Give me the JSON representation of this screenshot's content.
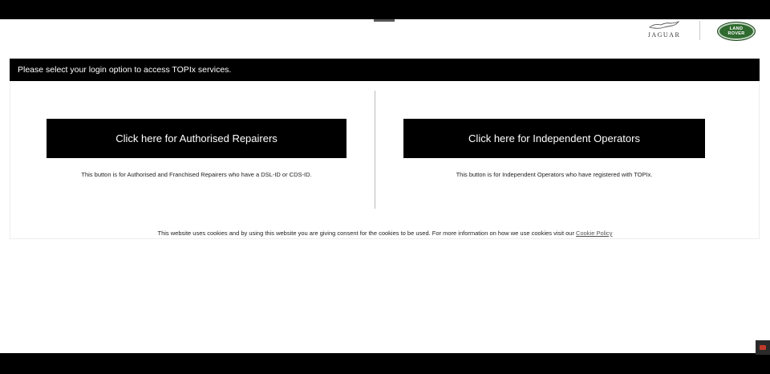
{
  "brands": {
    "jaguar": "JAGUAR",
    "landrover_line1": "LAND",
    "landrover_line2": "ROVER"
  },
  "header": {
    "text": "Please select your login option to access TOPIx services."
  },
  "options": [
    {
      "button_label": "Click here for Authorised Repairers",
      "description": "This button is for Authorised and Franchised Repairers who have a DSL-ID or CDS-ID."
    },
    {
      "button_label": "Click here for Independent Operators",
      "description": "This button is for Independent Operators who have registered with TOPIx."
    }
  ],
  "cookie": {
    "text": "This website uses cookies and by using this website you are giving consent for the cookies to be used. For more information on how we use cookies visit our",
    "link_label": "Cookie Policy"
  },
  "icons": {
    "jaguar_logo": "jaguar-leaper-icon",
    "landrover_logo": "land-rover-oval-icon",
    "corner": "folder-icon"
  },
  "colors": {
    "banner_bg": "#000000",
    "button_bg": "#000000",
    "landrover_green": "#2f6b2f"
  }
}
